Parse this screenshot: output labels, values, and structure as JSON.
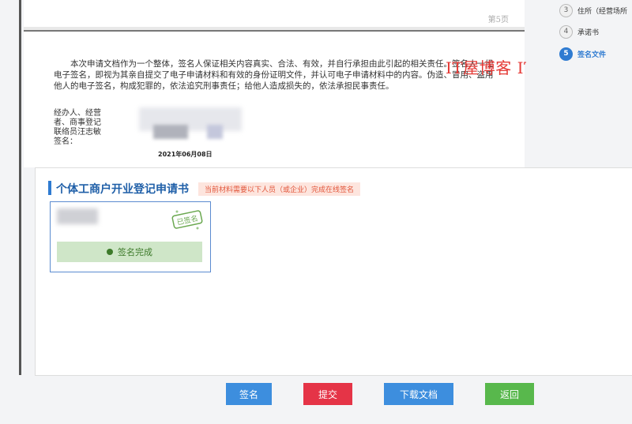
{
  "document": {
    "page_label": "第5页",
    "paragraph": "本次申请文档作为一个整体，签名人保证相关内容真实、合法、有效，并自行承担由此引起的相关责任。签名人一经电子签名，即视为其亲自提交了电子申请材料和有效的身份证明文件，并认可电子申请材料中的内容。伪造、冒用、盗用他人的电子签名，构成犯罪的，依法追究刑事责任；给他人造成损失的，依法承担民事责任。",
    "signer_label": "经办人、经营者、商事登记联络员汪志敏 签名：",
    "sign_date": "2021年06月08日"
  },
  "watermark": "IT屋博客 ITWUO.CN",
  "steps": [
    {
      "num": "3",
      "label": "住所（经营场所"
    },
    {
      "num": "4",
      "label": "承诺书"
    },
    {
      "num": "5",
      "label": "签名文件"
    }
  ],
  "panel": {
    "title": "个体工商户开业登记申请书",
    "tip": "当前材料需要以下人员（或企业）完成在线签名",
    "stamp_text": "已签名",
    "status": "签名完成"
  },
  "buttons": {
    "sign": "签名",
    "submit": "提交",
    "download": "下载文档",
    "back": "返回"
  }
}
